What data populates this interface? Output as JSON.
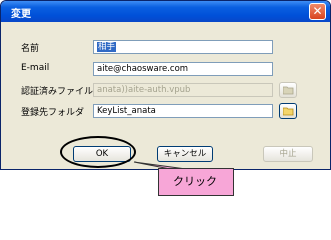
{
  "window": {
    "title": "変更",
    "close_glyph": "✕"
  },
  "form": {
    "name": {
      "label": "名前",
      "value": "相手"
    },
    "email": {
      "label": "E-mail",
      "value": "aite@chaosware.com"
    },
    "cert_file": {
      "label": "認証済みファイル",
      "value": "anata))aite-auth.vpub",
      "disabled": true
    },
    "folder": {
      "label": "登録先フォルダ",
      "value": "KeyList_anata"
    }
  },
  "buttons": {
    "ok": "OK",
    "cancel": "キャンセル",
    "abort": "中止"
  },
  "annotation": {
    "callout_text": "クリック",
    "callout_color": "#f7a6d7"
  },
  "colors": {
    "titlebar": "#0050d8",
    "dialog_bg": "#ece9d8",
    "selection": "#316ac5"
  }
}
